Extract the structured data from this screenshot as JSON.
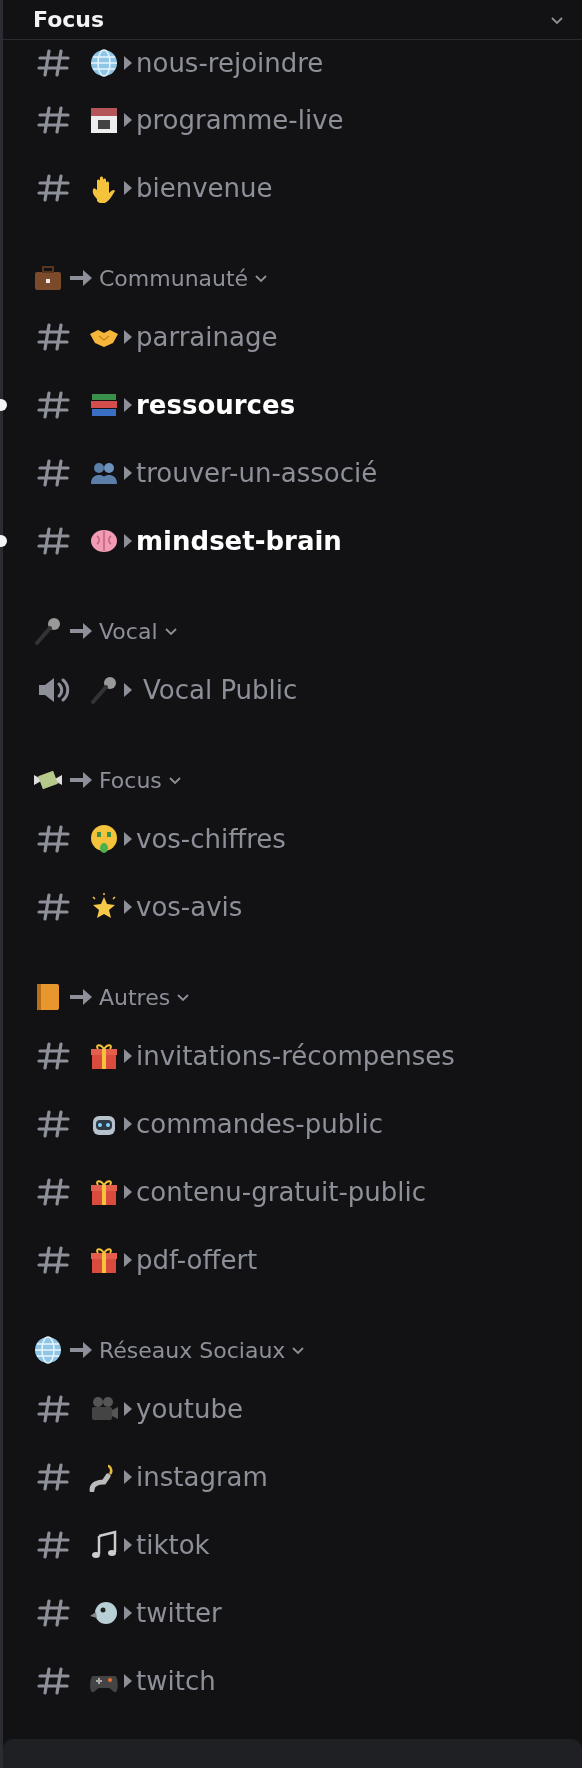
{
  "server_header": {
    "title": "Focus"
  },
  "sections": [
    {
      "channels": [
        {
          "kind": "text",
          "name": "nous-rejoindre",
          "unread": false
        },
        {
          "kind": "text",
          "name": "programme-live",
          "unread": false
        },
        {
          "kind": "text",
          "name": "bienvenue",
          "unread": false
        }
      ]
    },
    {
      "category": "Communauté",
      "expanded": true,
      "channels": [
        {
          "kind": "text",
          "name": "parrainage",
          "unread": false
        },
        {
          "kind": "text",
          "name": "ressources",
          "unread": true
        },
        {
          "kind": "text",
          "name": "trouver-un-associé",
          "unread": false
        },
        {
          "kind": "text",
          "name": "mindset-brain",
          "unread": true
        }
      ]
    },
    {
      "category": "Vocal",
      "expanded": true,
      "channels": [
        {
          "kind": "voice",
          "name": "Vocal Public",
          "unread": false
        }
      ]
    },
    {
      "category": "Focus",
      "expanded": true,
      "channels": [
        {
          "kind": "text",
          "name": "vos-chiffres",
          "unread": false
        },
        {
          "kind": "text",
          "name": "vos-avis",
          "unread": false
        }
      ]
    },
    {
      "category": "Autres",
      "expanded": true,
      "channels": [
        {
          "kind": "text",
          "name": "invitations-récompenses",
          "unread": false
        },
        {
          "kind": "text",
          "name": "commandes-public",
          "unread": false
        },
        {
          "kind": "text",
          "name": "contenu-gratuit-public",
          "unread": false
        },
        {
          "kind": "text",
          "name": "pdf-offert",
          "unread": false
        }
      ]
    },
    {
      "category": "Réseaux Sociaux",
      "expanded": true,
      "channels": [
        {
          "kind": "text",
          "name": "youtube",
          "unread": false
        },
        {
          "kind": "text",
          "name": "instagram",
          "unread": false
        },
        {
          "kind": "text",
          "name": "tiktok",
          "unread": false
        },
        {
          "kind": "text",
          "name": "twitter",
          "unread": false
        },
        {
          "kind": "text",
          "name": "twitch",
          "unread": false
        }
      ]
    }
  ]
}
